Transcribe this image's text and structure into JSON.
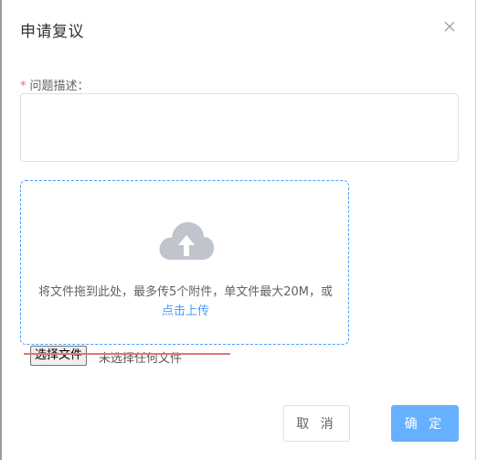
{
  "dialog": {
    "title": "申请复议"
  },
  "form": {
    "required_mark": "*",
    "description_label": "问题描述：",
    "description_value": ""
  },
  "upload": {
    "instructions": "将文件拖到此处，最多传5个附件，单文件最大20M，或",
    "link_text": "点击上传"
  },
  "file_input": {
    "button_label": "选择文件",
    "status_text": "未选择任何文件"
  },
  "footer": {
    "cancel_label": "取 消",
    "confirm_label": "确 定"
  },
  "colors": {
    "accent": "#409eff",
    "confirm_bg": "#66b1ff",
    "required": "#f56c6c",
    "cloud": "#c0c4cc"
  }
}
